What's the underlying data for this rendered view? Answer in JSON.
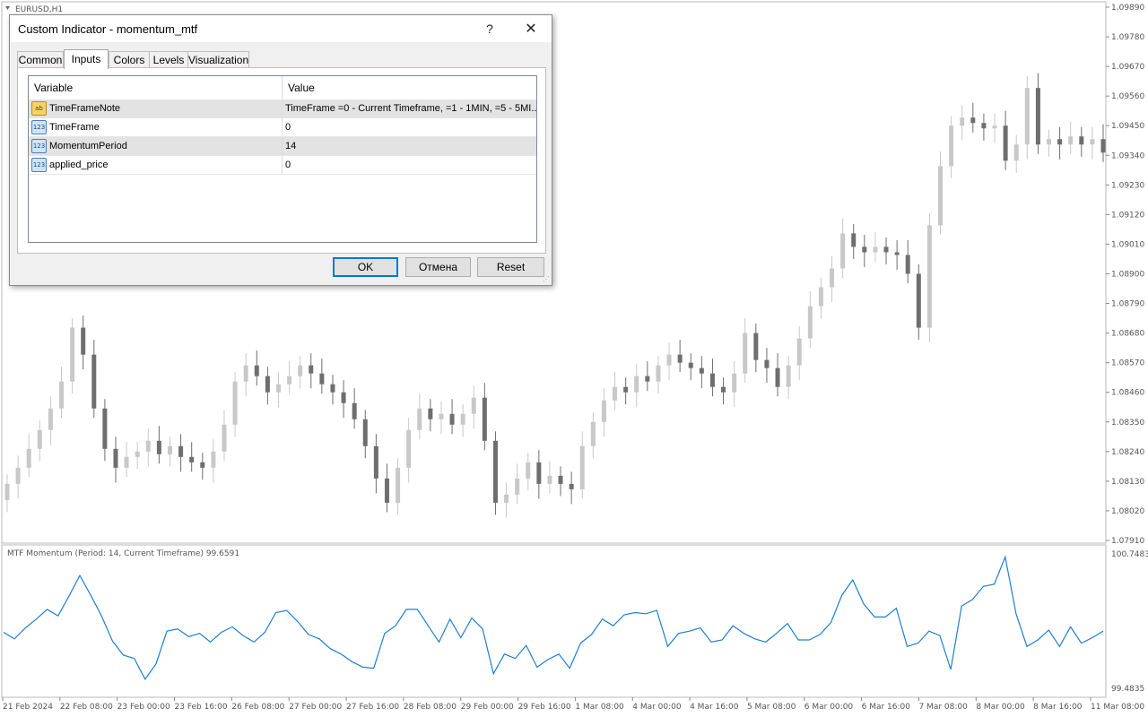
{
  "chart": {
    "symbol_label": "EURUSD,H1",
    "price_axis": [
      "1.09890",
      "1.09780",
      "1.09670",
      "1.09560",
      "1.09450",
      "1.09340",
      "1.09230",
      "1.09120",
      "1.09010",
      "1.08900",
      "1.08790",
      "1.08680",
      "1.08570",
      "1.08460",
      "1.08350",
      "1.08240",
      "1.08130",
      "1.08020",
      "1.07910"
    ],
    "price_range": [
      1.0791,
      1.0989
    ],
    "time_axis": [
      "21 Feb 2024",
      "22 Feb 08:00",
      "23 Feb 00:00",
      "23 Feb 16:00",
      "26 Feb 08:00",
      "27 Feb 00:00",
      "27 Feb 16:00",
      "28 Feb 08:00",
      "29 Feb 00:00",
      "29 Feb 16:00",
      "1 Mar 08:00",
      "4 Mar 00:00",
      "4 Mar 16:00",
      "5 Mar 08:00",
      "6 Mar 00:00",
      "6 Mar 16:00",
      "7 Mar 08:00",
      "8 Mar 00:00",
      "8 Mar 16:00",
      "11 Mar 08:00"
    ],
    "closes": [
      1.0812,
      1.0818,
      1.0825,
      1.0832,
      1.084,
      1.085,
      1.087,
      1.086,
      1.084,
      1.0825,
      1.0818,
      1.0822,
      1.0824,
      1.0828,
      1.0823,
      1.0826,
      1.0822,
      1.082,
      1.0818,
      1.0824,
      1.0834,
      1.085,
      1.0856,
      1.0852,
      1.0846,
      1.0849,
      1.0852,
      1.0856,
      1.0853,
      1.0849,
      1.0846,
      1.0842,
      1.0836,
      1.0826,
      1.0814,
      1.0805,
      1.0818,
      1.0832,
      1.084,
      1.0836,
      1.0838,
      1.0834,
      1.0838,
      1.0844,
      1.0828,
      1.0805,
      1.0808,
      1.0814,
      1.082,
      1.0812,
      1.0815,
      1.0812,
      1.081,
      1.0826,
      1.0835,
      1.0843,
      1.0848,
      1.0846,
      1.0852,
      1.085,
      1.0856,
      1.086,
      1.0857,
      1.0855,
      1.0853,
      1.0848,
      1.0846,
      1.0853,
      1.0868,
      1.0858,
      1.0855,
      1.0848,
      1.0856,
      1.0866,
      1.0878,
      1.0885,
      1.0892,
      1.0905,
      1.09,
      1.0898,
      1.09,
      1.0898,
      1.0897,
      1.089,
      1.087,
      1.0908,
      1.093,
      1.0945,
      1.0948,
      1.0946,
      1.0944,
      1.0945,
      1.0932,
      1.0938,
      1.0959,
      1.0938,
      1.094,
      1.0938,
      1.0941,
      1.0938,
      1.094,
      1.0935
    ],
    "momentum_label": "MTF Momentum (Period: 14, Current Timeframe) 99.6591",
    "momentum_axis": [
      "100.7483",
      "99.4835"
    ],
    "momentum_range": [
      99.4835,
      100.7483
    ],
    "momentum": [
      100.03,
      99.97,
      100.07,
      100.15,
      100.24,
      100.18,
      100.36,
      100.55,
      100.37,
      100.18,
      99.95,
      99.82,
      99.79,
      99.6,
      99.74,
      100.04,
      100.06,
      99.99,
      100.02,
      99.94,
      100.03,
      100.08,
      100.0,
      99.94,
      100.03,
      100.21,
      100.23,
      100.13,
      100.01,
      99.97,
      99.88,
      99.83,
      99.76,
      99.71,
      99.7,
      100.02,
      100.09,
      100.24,
      100.24,
      100.09,
      99.94,
      100.15,
      99.98,
      100.16,
      100.06,
      99.65,
      99.83,
      99.79,
      99.91,
      99.71,
      99.78,
      99.83,
      99.7,
      99.93,
      100.01,
      100.15,
      100.09,
      100.19,
      100.21,
      100.2,
      100.23,
      99.9,
      100.02,
      100.04,
      100.07,
      99.94,
      99.96,
      100.09,
      100.02,
      99.97,
      99.94,
      100.02,
      100.11,
      99.96,
      99.96,
      100.01,
      100.12,
      100.37,
      100.51,
      100.29,
      100.17,
      100.17,
      100.25,
      99.9,
      99.93,
      100.04,
      100.0,
      99.69,
      100.27,
      100.33,
      100.45,
      100.47,
      100.72,
      100.2,
      99.9,
      99.96,
      100.05,
      99.9,
      100.08,
      99.93,
      99.98,
      100.04
    ]
  },
  "dialog": {
    "title": "Custom Indicator - momentum_mtf",
    "help_label": "?",
    "close_label": "✕",
    "tabs": [
      "Common",
      "Inputs",
      "Colors",
      "Levels",
      "Visualization"
    ],
    "active_tab": "Inputs",
    "columns": [
      "Variable",
      "Value"
    ],
    "rows": [
      {
        "icon": "ab",
        "name": "TimeFrameNote",
        "value": "TimeFrame =0 - Current Timeframe, =1 - 1MIN, =5 - 5MI..."
      },
      {
        "icon": "123",
        "name": "TimeFrame",
        "value": "0"
      },
      {
        "icon": "123",
        "name": "MomentumPeriod",
        "value": "14"
      },
      {
        "icon": "123",
        "name": "applied_price",
        "value": "0"
      }
    ],
    "buttons": {
      "ok": "OK",
      "cancel": "Отмена",
      "reset": "Reset"
    }
  },
  "colors": {
    "bull_candle": "#c8c8c8",
    "bear_candle": "#6e6e6e",
    "momentum_line": "#1e7fd6",
    "accent": "#0078d7"
  },
  "icons": {
    "string_var": "ab-string-icon",
    "number_var": "number-123-icon"
  }
}
